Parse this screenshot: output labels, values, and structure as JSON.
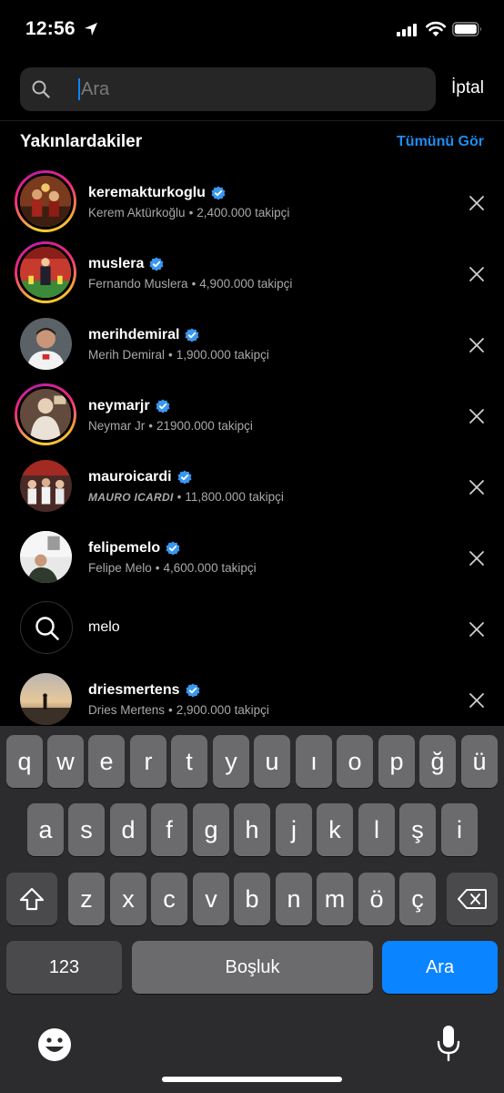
{
  "status": {
    "time": "12:56"
  },
  "header": {
    "search_placeholder": "Ara",
    "cancel_label": "İptal"
  },
  "section": {
    "title": "Yakınlardakiler",
    "see_all": "Tümünü Gör"
  },
  "accent_color": "#1c8ef1",
  "recent": [
    {
      "type": "user",
      "username": "keremakturkoglu",
      "name": "Kerem Aktürkoğlu",
      "followers": "2,400.000 takipçi",
      "verified": true,
      "story_ring": true
    },
    {
      "type": "user",
      "username": "muslera",
      "name": "Fernando Muslera",
      "followers": "4,900.000 takipçi",
      "verified": true,
      "story_ring": true
    },
    {
      "type": "user",
      "username": "merihdemiral",
      "name": "Merih Demiral",
      "followers": "1,900.000 takipçi",
      "verified": true,
      "story_ring": false
    },
    {
      "type": "user",
      "username": "neymarjr",
      "name": "Neymar Jr",
      "followers": "21900.000 takipçi",
      "verified": true,
      "story_ring": true
    },
    {
      "type": "user",
      "username": "mauroicardi",
      "name": "MAURO ICARDI",
      "followers": "11,800.000 takipçi",
      "verified": true,
      "story_ring": false
    },
    {
      "type": "user",
      "username": "felipemelo",
      "name": "Felipe Melo",
      "followers": "4,600.000 takipçi",
      "verified": true,
      "story_ring": false
    },
    {
      "type": "query",
      "text": "melo"
    },
    {
      "type": "user",
      "username": "driesmertens",
      "name": "Dries Mertens",
      "followers": "2,900.000 takipçi",
      "verified": true,
      "story_ring": false
    }
  ],
  "sep": "•",
  "keyboard": {
    "row1": [
      "q",
      "w",
      "e",
      "r",
      "t",
      "y",
      "u",
      "ı",
      "o",
      "p",
      "ğ",
      "ü"
    ],
    "row2": [
      "a",
      "s",
      "d",
      "f",
      "g",
      "h",
      "j",
      "k",
      "l",
      "ş",
      "i"
    ],
    "row3": [
      "z",
      "x",
      "c",
      "v",
      "b",
      "n",
      "m",
      "ö",
      "ç"
    ],
    "numbers_label": "123",
    "space_label": "Boşluk",
    "action_label": "Ara"
  }
}
